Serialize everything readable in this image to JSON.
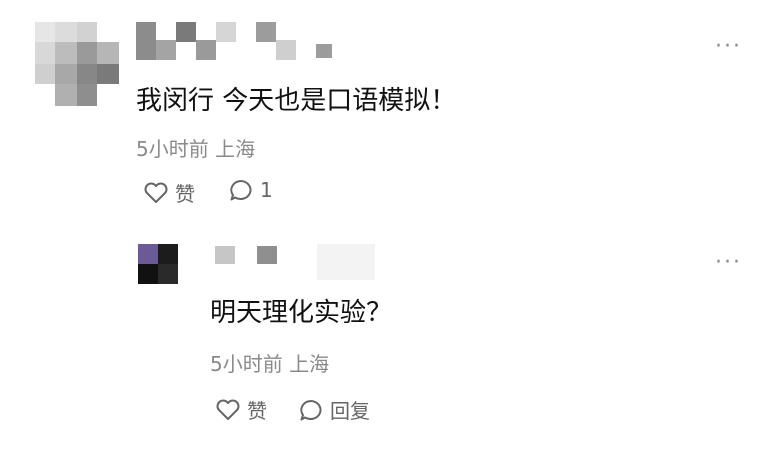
{
  "comment": {
    "text": "我闵行 今天也是口语模拟！",
    "meta": "5小时前 上海",
    "like_label": "赞",
    "reply_count": "1",
    "more_label": "···",
    "icons": {
      "like": "heart-icon",
      "reply": "comment-bubble-icon",
      "more": "more-options-icon"
    }
  },
  "reply": {
    "text": "明天理化实验？",
    "meta": "5小时前 上海",
    "like_label": "赞",
    "reply_label": "回复",
    "more_label": "···",
    "icons": {
      "like": "heart-icon",
      "reply": "comment-bubble-icon",
      "more": "more-options-icon"
    }
  }
}
